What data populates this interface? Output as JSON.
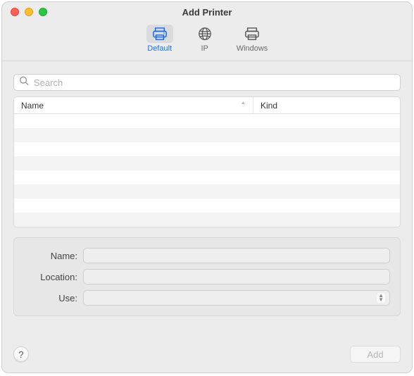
{
  "window": {
    "title": "Add Printer"
  },
  "toolbar": {
    "tabs": [
      {
        "id": "default",
        "label": "Default",
        "icon": "printer-icon",
        "selected": true
      },
      {
        "id": "ip",
        "label": "IP",
        "icon": "globe-icon",
        "selected": false
      },
      {
        "id": "windows",
        "label": "Windows",
        "icon": "printer-alt-icon",
        "selected": false
      }
    ]
  },
  "search": {
    "placeholder": "Search",
    "value": ""
  },
  "table": {
    "columns": [
      {
        "key": "name",
        "label": "Name",
        "sort": "asc"
      },
      {
        "key": "kind",
        "label": "Kind"
      }
    ],
    "rows": []
  },
  "form": {
    "name": {
      "label": "Name:",
      "value": ""
    },
    "location": {
      "label": "Location:",
      "value": ""
    },
    "use": {
      "label": "Use:",
      "value": ""
    }
  },
  "footer": {
    "help_tooltip": "?",
    "add_label": "Add",
    "add_enabled": false
  }
}
